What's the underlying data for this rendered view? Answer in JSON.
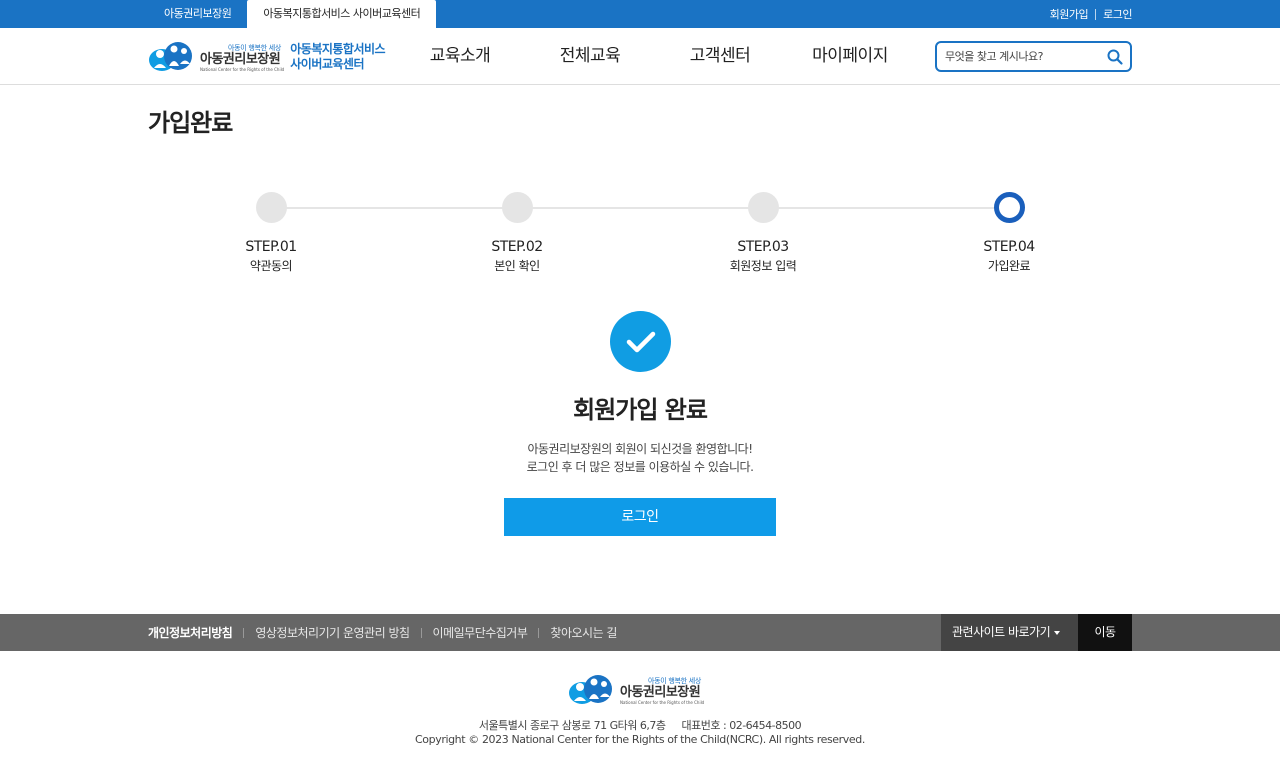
{
  "topbar": {
    "sites": [
      "아동권리보장원",
      "아동복지통합서비스 사이버교육센터"
    ],
    "util": {
      "join": "회원가입",
      "login": "로그인"
    }
  },
  "header": {
    "logo": {
      "slogan": "아동이 행복한 세상",
      "org": "아동권리보장원",
      "eng": "National Center for the Rights of the Child",
      "sub_line1": "아동복지통합서비스",
      "sub_line2": "사이버교육센터"
    },
    "menu": [
      "교육소개",
      "전체교육",
      "고객센터",
      "마이페이지"
    ],
    "search": {
      "placeholder": "무엇을 찾고 계시나요?"
    }
  },
  "page": {
    "title": "가입완료"
  },
  "steps": [
    {
      "num": "STEP.01",
      "label": "약관동의",
      "state": "done"
    },
    {
      "num": "STEP.02",
      "label": "본인 확인",
      "state": "done"
    },
    {
      "num": "STEP.03",
      "label": "회원정보 입력",
      "state": "done"
    },
    {
      "num": "STEP.04",
      "label": "가입완료",
      "state": "current"
    }
  ],
  "complete": {
    "icon": "check-icon",
    "title": "회원가입 완료",
    "message_line1": "아동권리보장원의 회원이 되신것을 환영합니다!",
    "message_line2": "로그인 후 더 많은 정보를 이용하실 수 있습니다.",
    "button": "로그인"
  },
  "footer": {
    "links": [
      "개인정보처리방침",
      "영상정보처리기기 운영관리 방침",
      "이메일무단수집거부",
      "찾아오시는 길"
    ],
    "family_site": "관련사이트 바로가기",
    "go": "이동",
    "logo": {
      "slogan": "아동이 행복한 세상",
      "org": "아동권리보장원",
      "eng": "National Center for the Rights of the Child"
    },
    "address": "서울특별시 종로구 삼봉로 71 G타워 6,7층",
    "tel": "대표번호 : 02-6454-8500",
    "copyright": "Copyright © 2023 National Center for the Rights of the Child(NCRC). All rights reserved."
  },
  "colors": {
    "primary": "#1a73c4",
    "accent": "#0f9be8",
    "step_current": "#1a5fbc",
    "footer_bar": "#666666"
  }
}
